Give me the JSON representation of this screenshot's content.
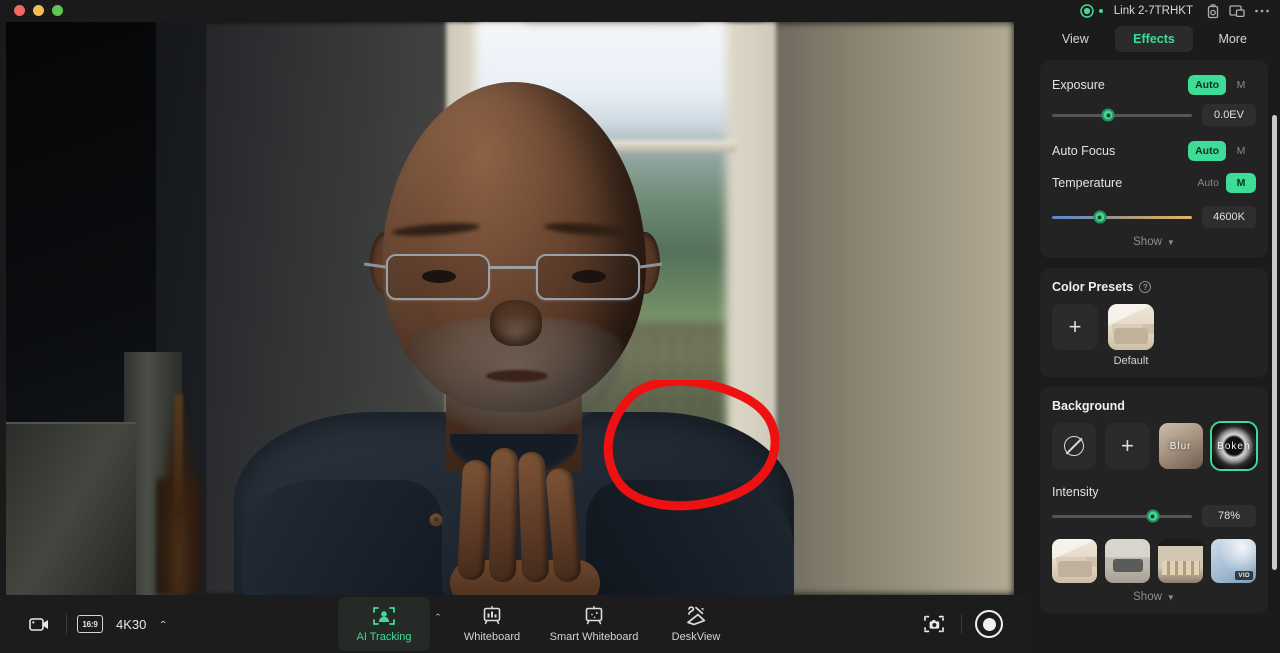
{
  "window": {
    "traffic_lights": [
      "close",
      "minimize",
      "maximize"
    ]
  },
  "device": {
    "name": "Link 2-7TRHKT",
    "status_dot": "connected",
    "indicator_color": "#3ddc97",
    "header_icons": [
      "camera-settings-icon",
      "picture-in-picture-icon",
      "more-options-icon"
    ]
  },
  "tabs": [
    {
      "id": "view",
      "label": "View",
      "active": false
    },
    {
      "id": "effects",
      "label": "Effects",
      "active": true
    },
    {
      "id": "more",
      "label": "More",
      "active": false
    }
  ],
  "camera_controls": {
    "exposure": {
      "label": "Exposure",
      "mode_auto_label": "Auto",
      "mode_manual_label": "M",
      "mode": "auto",
      "slider_percent": 40,
      "value": "0.0EV"
    },
    "auto_focus": {
      "label": "Auto Focus",
      "mode_auto_label": "Auto",
      "mode_manual_label": "M",
      "mode": "auto"
    },
    "temperature": {
      "label": "Temperature",
      "mode_auto_label": "Auto",
      "mode_manual_label": "M",
      "mode": "manual",
      "slider_percent": 34,
      "value": "4600K"
    },
    "show_more_label": "Show",
    "show_caret": "▼"
  },
  "color_presets": {
    "title": "Color Presets",
    "help_icon": "question-mark-icon",
    "add_label": "+",
    "items": [
      {
        "id": "default",
        "label": "Default",
        "thumb": "bedroom",
        "selected": false
      }
    ]
  },
  "background": {
    "title": "Background",
    "options": [
      {
        "id": "none",
        "label": "",
        "icon": "no-background-icon",
        "selected": false
      },
      {
        "id": "add",
        "label": "+",
        "icon": "plus-icon",
        "selected": false
      },
      {
        "id": "blur",
        "label": "Blur",
        "icon": "blur-thumb",
        "selected": false
      },
      {
        "id": "bokeh",
        "label": "Bokeh",
        "icon": "bokeh-thumb",
        "selected": true
      }
    ],
    "intensity": {
      "label": "Intensity",
      "slider_percent": 72,
      "value": "78%"
    },
    "thumbnails": [
      {
        "id": "bedroom",
        "style": "thumb-bedroom",
        "badge": ""
      },
      {
        "id": "living-room",
        "style": "thumb-living",
        "badge": ""
      },
      {
        "id": "office",
        "style": "thumb-office",
        "badge": ""
      },
      {
        "id": "abstract",
        "style": "thumb-abstract",
        "badge": "VID"
      }
    ],
    "show_more_label": "Show",
    "show_caret": "▼"
  },
  "toolbar": {
    "camera_icon": "video-camera-icon",
    "aspect_ratio": "16:9",
    "resolution": "4K30",
    "resolution_caret": "⌃",
    "modes": [
      {
        "id": "ai-tracking",
        "label": "AI Tracking",
        "icon": "face-tracking-icon",
        "active": true
      },
      {
        "id": "whiteboard",
        "label": "Whiteboard",
        "icon": "whiteboard-icon",
        "active": false
      },
      {
        "id": "smart-whiteboard",
        "label": "Smart Whiteboard",
        "icon": "smart-whiteboard-icon",
        "active": false
      },
      {
        "id": "deskview",
        "label": "DeskView",
        "icon": "deskview-icon",
        "active": false
      }
    ],
    "mode_caret": "⌃",
    "snapshot_icon": "snapshot-icon",
    "record_icon": "record-icon"
  },
  "annotation": {
    "type": "hand-drawn-ellipse",
    "color": "#ee1111"
  }
}
